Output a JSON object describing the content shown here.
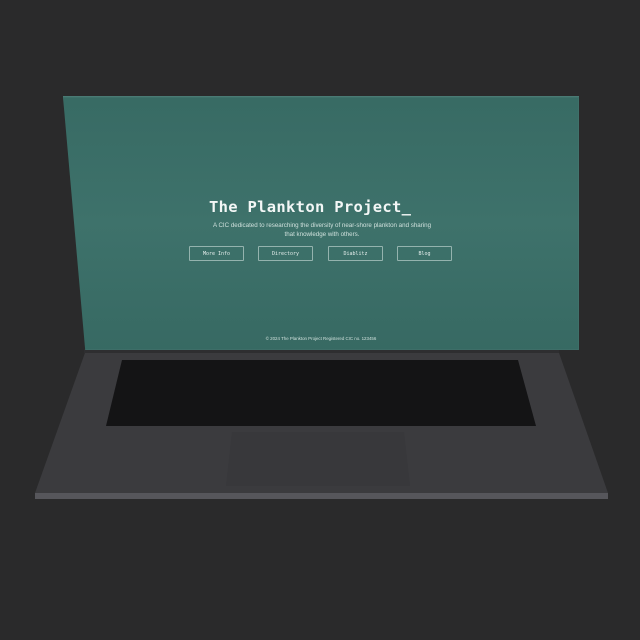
{
  "colors": {
    "background": "#2a2a2b",
    "screen": "#3a6f68",
    "laptop_body": "#3b3b3e",
    "keyboard_well": "#141415"
  },
  "website": {
    "title": "The Plankton Project_",
    "tagline": "A CIC dedicated to researching the diversity of near-shore plankton and sharing that knowledge with others.",
    "nav": [
      {
        "label": "More Info"
      },
      {
        "label": "Directory"
      },
      {
        "label": "Diablitz"
      },
      {
        "label": "Blog"
      }
    ],
    "footer": "© 2024 The Plankton Project Registered CIC no. 123456"
  }
}
